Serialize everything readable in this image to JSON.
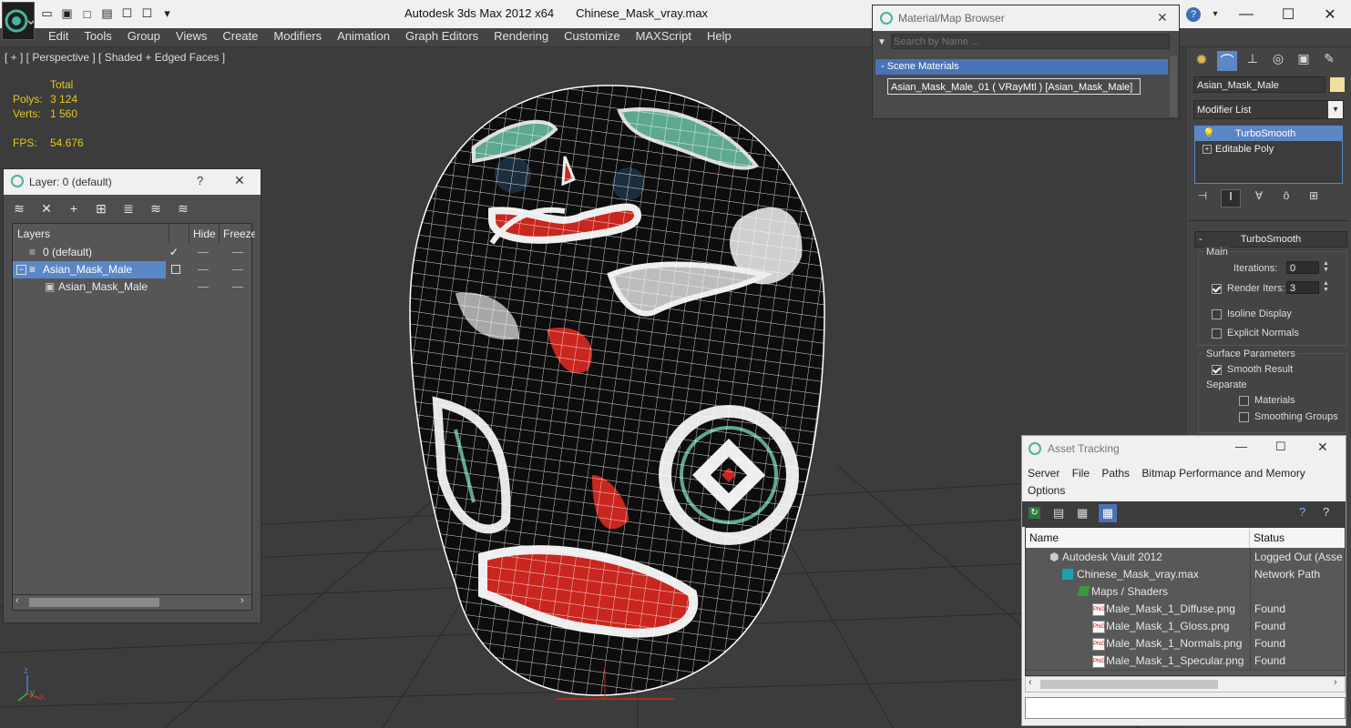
{
  "app": {
    "title": "Autodesk 3ds Max  2012 x64",
    "file": "Chinese_Mask_vray.max",
    "quick_access_icons": [
      "open-file-icon",
      "save-icon",
      "new-icon",
      "hold-icon",
      "window-icon",
      "window-icon",
      "dropdown-icon"
    ]
  },
  "menu": [
    "Edit",
    "Tools",
    "Group",
    "Views",
    "Create",
    "Modifiers",
    "Animation",
    "Graph Editors",
    "Rendering",
    "Customize",
    "MAXScript",
    "Help"
  ],
  "viewport": {
    "label": "[ + ] [ Perspective ] [ Shaded + Edged Faces ]",
    "stats_header": "Total",
    "polys_label": "Polys:",
    "polys_value": "3 124",
    "verts_label": "Verts:",
    "verts_value": "1 560",
    "fps_label": "FPS:",
    "fps_value": "54.676",
    "axis_x": "x",
    "axis_y": "y",
    "axis_z": "z"
  },
  "layer_panel": {
    "title": "Layer: 0 (default)",
    "help": "?",
    "close": "✕",
    "headers": {
      "layers": "Layers",
      "hide": "Hide",
      "freeze": "Freeze"
    },
    "rows": [
      {
        "name": "0 (default)"
      },
      {
        "name": "Asian_Mask_Male"
      },
      {
        "name": "Asian_Mask_Male"
      }
    ]
  },
  "material_browser": {
    "title": "Material/Map Browser",
    "search_placeholder": "Search by Name ...",
    "group": "- Scene Materials",
    "material": "Asian_Mask_Male_01  ( VRayMtl )  [Asian_Mask_Male]"
  },
  "command_panel": {
    "object_name": "Asian_Mask_Male",
    "modifier_list": "Modifier List",
    "stack": [
      "TurboSmooth",
      "Editable Poly"
    ],
    "rollout_title": "TurboSmooth",
    "main_label": "Main",
    "iterations_label": "Iterations:",
    "iterations_value": "0",
    "render_iters_label": "Render Iters:",
    "render_iters_value": "3",
    "isoline_label": "Isoline Display",
    "explicit_normals_label": "Explicit Normals",
    "surface_params_label": "Surface Parameters",
    "smooth_result_label": "Smooth Result",
    "separate_label": "Separate",
    "materials_label": "Materials",
    "smoothing_groups_label": "Smoothing Groups"
  },
  "asset_tracking": {
    "title": "Asset Tracking",
    "menus": [
      "Server",
      "File",
      "Paths",
      "Bitmap Performance and Memory",
      "Options"
    ],
    "headers": {
      "name": "Name",
      "status": "Status"
    },
    "rows": [
      {
        "name": "Autodesk Vault 2012",
        "status": "Logged Out (Asse"
      },
      {
        "name": "Chinese_Mask_vray.max",
        "status": "Network Path"
      },
      {
        "name": "Maps / Shaders",
        "status": ""
      },
      {
        "name": "Male_Mask_1_Diffuse.png",
        "status": "Found"
      },
      {
        "name": "Male_Mask_1_Gloss.png",
        "status": "Found"
      },
      {
        "name": "Male_Mask_1_Normals.png",
        "status": "Found"
      },
      {
        "name": "Male_Mask_1_Specular.png",
        "status": "Found"
      }
    ]
  },
  "colors": {
    "stats_yellow": "#e6c618",
    "selection_blue": "#5b87c7",
    "mask_black": "#0d0d0d",
    "mask_red": "#c8261e",
    "mask_teal": "#5ea892"
  }
}
